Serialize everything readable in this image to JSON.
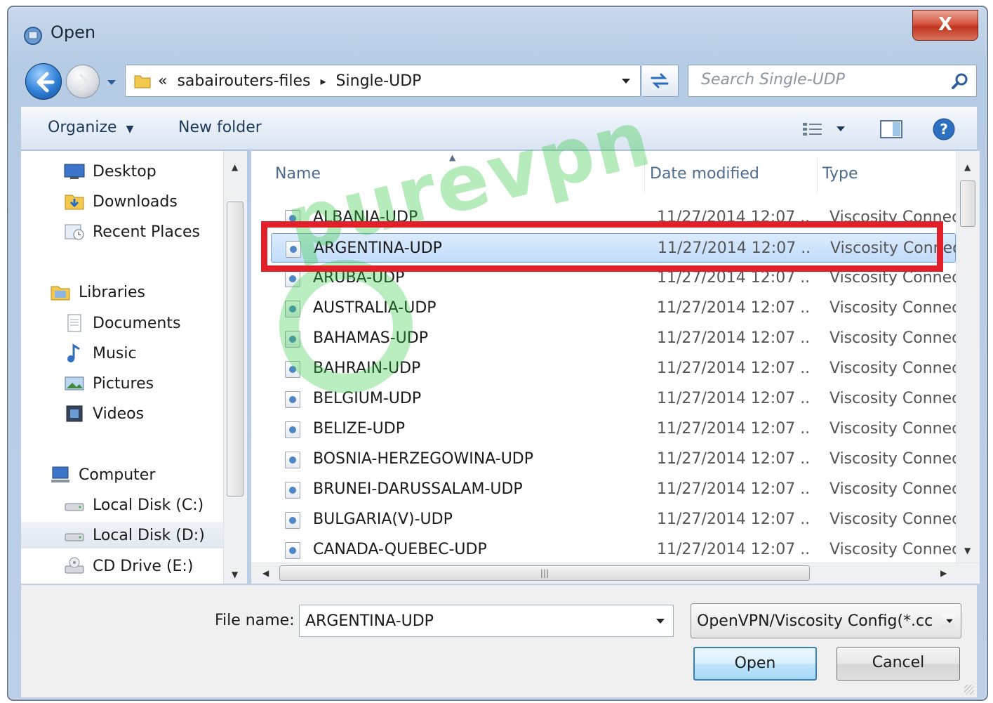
{
  "window": {
    "title": "Open",
    "close_label": "X"
  },
  "address_bar": {
    "overflow": "«",
    "crumbs": [
      "sabairouters-files",
      "Single-UDP"
    ],
    "separator": "▸"
  },
  "search": {
    "placeholder": "Search Single-UDP"
  },
  "toolbar": {
    "organize": "Organize",
    "new_folder": "New folder"
  },
  "nav": {
    "favorites": [
      "Desktop",
      "Downloads",
      "Recent Places"
    ],
    "libraries_label": "Libraries",
    "libraries": [
      "Documents",
      "Music",
      "Pictures",
      "Videos"
    ],
    "computer_label": "Computer",
    "drives": [
      "Local Disk (C:)",
      "Local Disk (D:)",
      "CD Drive (E:)"
    ],
    "selected": "Local Disk (D:)"
  },
  "columns": {
    "name": "Name",
    "date": "Date modified",
    "type": "Type"
  },
  "files": [
    {
      "name": "ALBANIA-UDP",
      "date": "11/27/2014 12:07 ...",
      "type": "Viscosity Connect"
    },
    {
      "name": "ARGENTINA-UDP",
      "date": "11/27/2014 12:07 ...",
      "type": "Viscosity Connect"
    },
    {
      "name": "ARUBA-UDP",
      "date": "11/27/2014 12:07 ...",
      "type": "Viscosity Connect"
    },
    {
      "name": "AUSTRALIA-UDP",
      "date": "11/27/2014 12:07 ...",
      "type": "Viscosity Connect"
    },
    {
      "name": "BAHAMAS-UDP",
      "date": "11/27/2014 12:07 ...",
      "type": "Viscosity Connect"
    },
    {
      "name": "BAHRAIN-UDP",
      "date": "11/27/2014 12:07 ...",
      "type": "Viscosity Connect"
    },
    {
      "name": "BELGIUM-UDP",
      "date": "11/27/2014 12:07 ...",
      "type": "Viscosity Connect"
    },
    {
      "name": "BELIZE-UDP",
      "date": "11/27/2014 12:07 ...",
      "type": "Viscosity Connect"
    },
    {
      "name": "BOSNIA-HERZEGOWINA-UDP",
      "date": "11/27/2014 12:07 ...",
      "type": "Viscosity Connect"
    },
    {
      "name": "BRUNEI-DARUSSALAM-UDP",
      "date": "11/27/2014 12:07 ...",
      "type": "Viscosity Connect"
    },
    {
      "name": "BULGARIA(V)-UDP",
      "date": "11/27/2014 12:07 ...",
      "type": "Viscosity Connect"
    },
    {
      "name": "CANADA-QUEBEC-UDP",
      "date": "11/27/2014 12:07 ...",
      "type": "Viscosity Connect"
    }
  ],
  "selected_file": "ARGENTINA-UDP",
  "file_name": {
    "label": "File name:",
    "value": "ARGENTINA-UDP"
  },
  "file_type": {
    "value": "OpenVPN/Viscosity Config(*.cc"
  },
  "buttons": {
    "open": "Open",
    "cancel": "Cancel"
  },
  "watermark": {
    "text": "purevpn"
  },
  "colors": {
    "highlight_box": "#e1202a",
    "watermark": "#2ec83c",
    "accent": "#3c7fb1"
  }
}
